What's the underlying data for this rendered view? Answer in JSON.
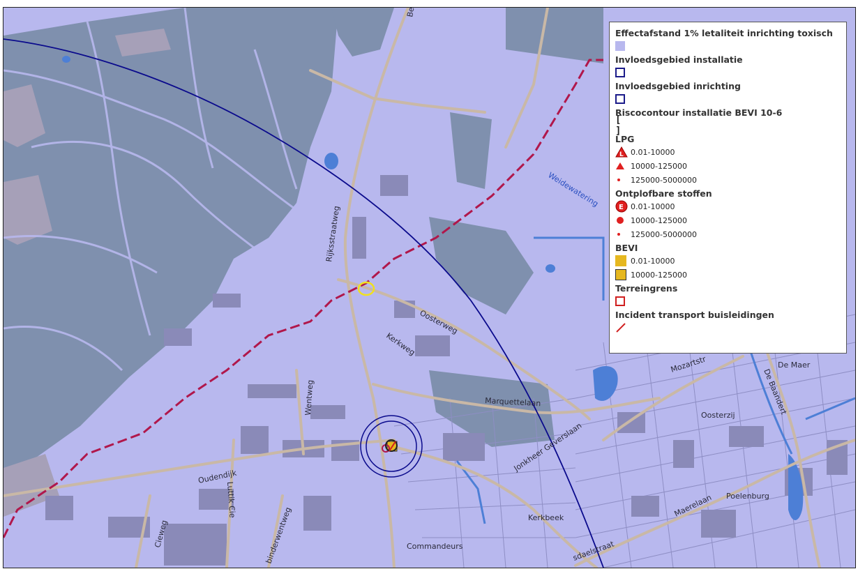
{
  "map": {
    "labels": {
      "rijksstraatweg": "Rijksstraatweg",
      "oosterweg": "Oosterweg",
      "kerkweg": "Kerkweg",
      "marquettelaan": "Marquettelaan",
      "oudendijk": "Oudendijk",
      "wentweg": "Wentweg",
      "luttik_cie": "Luttik Cie",
      "cieweg": "Cieweg",
      "binderwentweg": "binderwentweg",
      "jonkheer": "Jonkheer Geverslaan",
      "kerkbeek": "Kerkbeek",
      "commandeurs": "Commandeurs",
      "poelenburg": "Poelenburg",
      "maerelaan": "Maerelaan",
      "oosterzij": "Oosterzij",
      "de_maer": "De Maer",
      "de_baandert": "De Baandert",
      "mozartstr": "Mozartstr",
      "weidewatering": "Weidewatering",
      "sdaelstraat": "sdaelstraat",
      "be": "Be"
    }
  },
  "legend": {
    "sections": [
      {
        "title": "Effectafstand 1% letaliteit inrichting toxisch",
        "symbol": "fill-lavender",
        "items": []
      },
      {
        "title": "Invloedsgebied installatie",
        "symbol": "box-navy",
        "items": []
      },
      {
        "title": "Invloedsgebied inrichting",
        "symbol": "box-navy",
        "items": []
      },
      {
        "title": "Riscocontour installatie BEVI 10-6",
        "symbol": "bracket",
        "items": []
      },
      {
        "title": "LPG",
        "symbol": "",
        "items": [
          {
            "label": "0.01-10000",
            "symbol": "triangle-L"
          },
          {
            "label": "10000-125000",
            "symbol": "triangle-small"
          },
          {
            "label": "125000-5000000",
            "symbol": "dot"
          }
        ]
      },
      {
        "title": "Ontplofbare stoffen",
        "symbol": "",
        "items": [
          {
            "label": "0.01-10000",
            "symbol": "circle-E"
          },
          {
            "label": "10000-125000",
            "symbol": "circle-small"
          },
          {
            "label": "125000-5000000",
            "symbol": "dot"
          }
        ]
      },
      {
        "title": "BEVI",
        "symbol": "",
        "items": [
          {
            "label": "0.01-10000",
            "symbol": "gold-square"
          },
          {
            "label": "10000-125000",
            "symbol": "gold-square-border"
          }
        ]
      },
      {
        "title": "Terreingrens",
        "symbol": "box-red",
        "items": []
      },
      {
        "title": "Incident transport buisleidingen",
        "symbol": "red-dash",
        "items": []
      }
    ]
  },
  "colors": {
    "background": "#b8b8ee",
    "forest": "#7f90ae",
    "road": "#c9b8a6",
    "pipeline": "#b0174b",
    "contour": "#0a0a8c",
    "bevi": "#e6b820",
    "lpg": "#e02020"
  }
}
